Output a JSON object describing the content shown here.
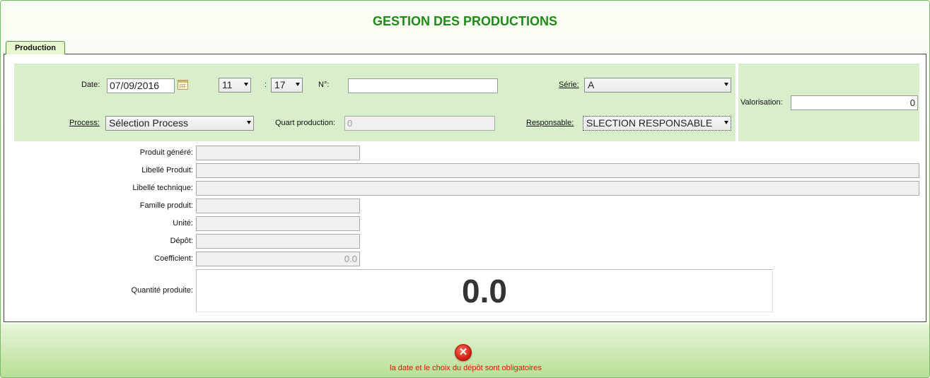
{
  "window": {
    "title": "GESTION DES PRODUCTIONS"
  },
  "tabs": [
    {
      "label": "Production",
      "active": true
    }
  ],
  "header": {
    "date_label": "Date:",
    "date_value": "07/09/2016",
    "hour_value": "11",
    "time_separator": ":",
    "minute_value": "17",
    "number_label": "N°:",
    "number_value": "",
    "serie_label": "Série:",
    "serie_value": "A",
    "process_label": "Process:",
    "process_value": "Sélection Process",
    "quart_label": "Quart production:",
    "quart_value": "0",
    "responsable_label": "Responsable:",
    "responsable_value": "SLECTION RESPONSABLE",
    "valorisation_label": "Valorisation:",
    "valorisation_value": "0"
  },
  "details": {
    "produit_genere_label": "Produit généré:",
    "produit_genere_value": "",
    "libelle_produit_label": "Libellé Produit:",
    "libelle_produit_value": "",
    "libelle_technique_label": "Libellé technique:",
    "libelle_technique_value": "",
    "famille_label": "Famille produit:",
    "famille_value": "",
    "unite_label": "Unité:",
    "unite_value": "",
    "depot_label": "Dépôt:",
    "depot_value": "",
    "coefficient_label": "Coefficient:",
    "coefficient_value": "0.0",
    "quantite_label": "Quantité produite:",
    "quantite_value": "0.0"
  },
  "footer": {
    "error_icon": "error-x-icon",
    "error_message": "la date et le choix du dépôt sont obligatoires"
  },
  "colors": {
    "title": "#1f8a16",
    "header_bg": "#d9efcb",
    "error": "#e0140a"
  }
}
